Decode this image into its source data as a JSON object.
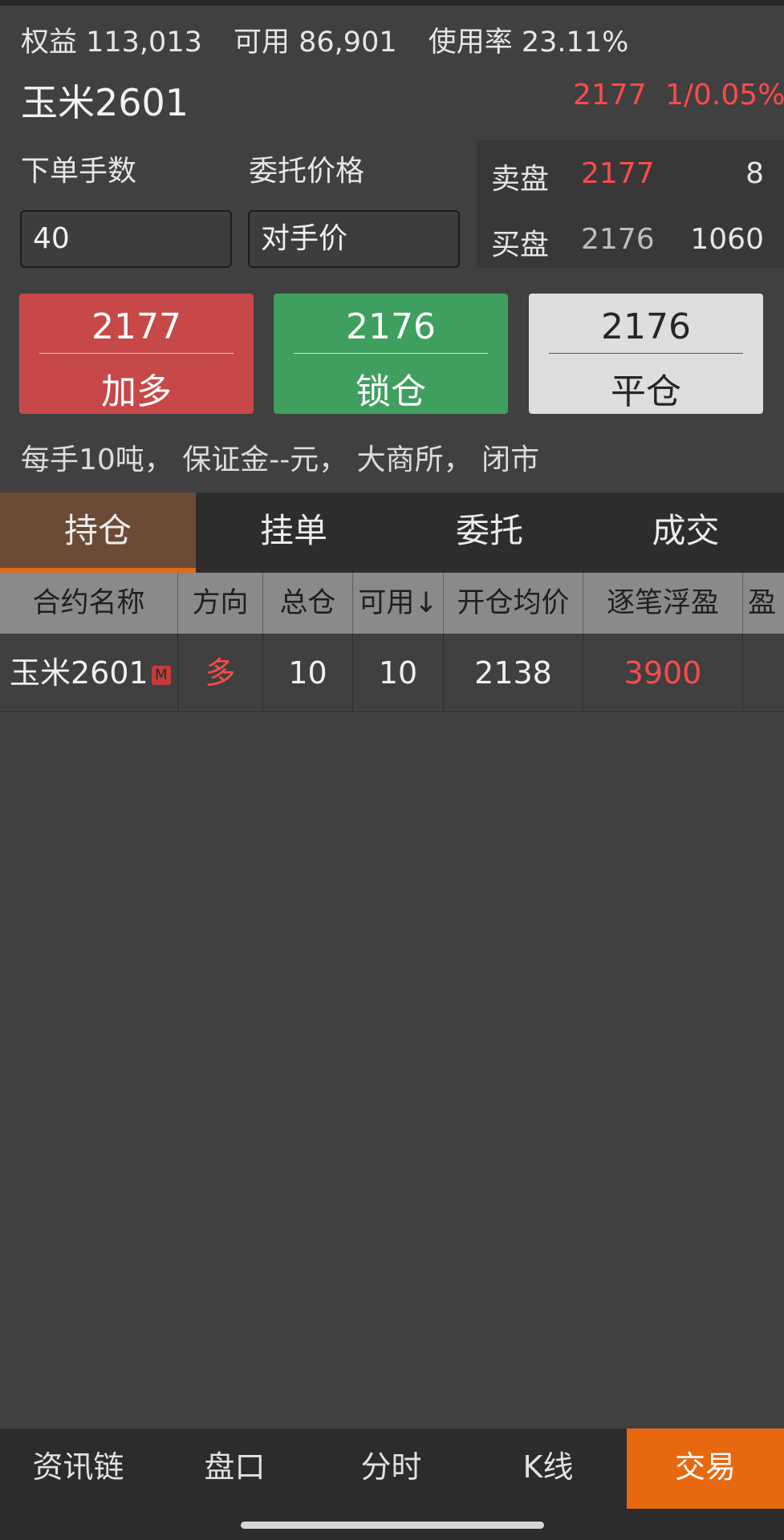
{
  "account": {
    "equity": "权益 113,013",
    "available": "可用 86,901",
    "usage": "使用率 23.11%"
  },
  "contract": {
    "name": "玉米2601",
    "price": "2177",
    "change": "1/0.05%"
  },
  "order": {
    "qty_label": "下单手数",
    "price_label": "委托价格",
    "qty_value": "40",
    "price_value": "对手价"
  },
  "book": {
    "sell_label": "卖盘",
    "sell_price": "2177",
    "sell_volume": "8",
    "buy_label": "买盘",
    "buy_price": "2176",
    "buy_volume": "1060"
  },
  "actions": {
    "long_price": "2177",
    "long_label": "加多",
    "lock_price": "2176",
    "lock_label": "锁仓",
    "close_price": "2176",
    "close_label": "平仓"
  },
  "info_line": "每手10吨， 保证金--元， 大商所， 闭市",
  "tabs": [
    "持仓",
    "挂单",
    "委托",
    "成交"
  ],
  "table": {
    "headers": [
      "合约名称",
      "方向",
      "总仓",
      "可用↓",
      "开仓均价",
      "逐笔浮盈",
      "盈"
    ],
    "rows": [
      {
        "name": "玉米2601",
        "badge": "M",
        "direction": "多",
        "total": "10",
        "available": "10",
        "avg_price": "2138",
        "float_pnl": "3900",
        "extra": ""
      }
    ]
  },
  "bottom_nav": [
    "资讯链",
    "盘口",
    "分时",
    "K线",
    "交易"
  ],
  "colors": {
    "up": "#ff4a4a",
    "long_button": "#c64848",
    "lock_button": "#3f9f5e",
    "close_button": "#dedede",
    "accent": "#e8680f"
  }
}
